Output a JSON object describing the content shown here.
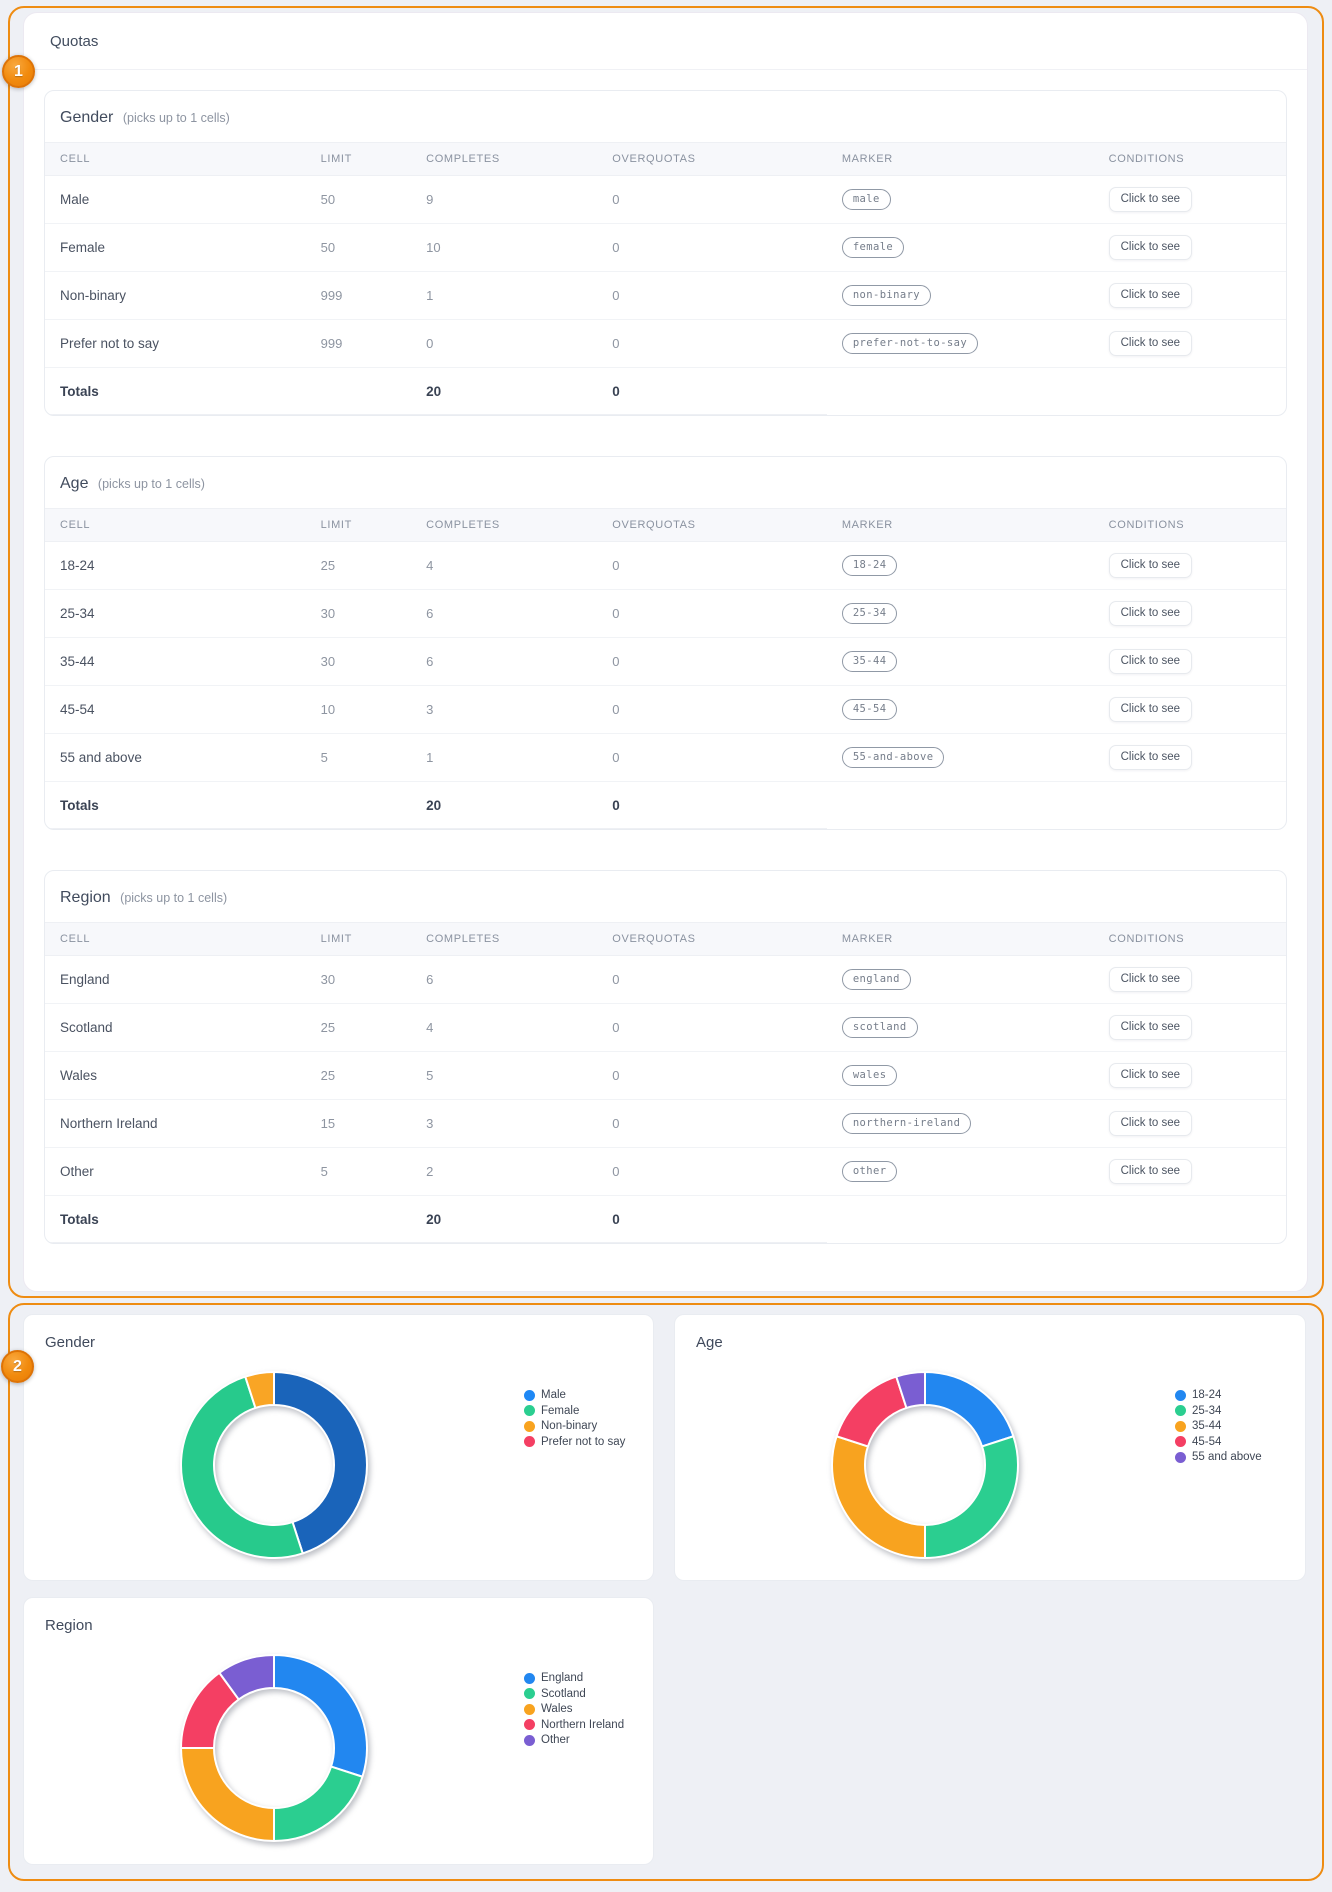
{
  "accent": {
    "annotation_orange": "#ee8c12",
    "badge_fill": "#f18a0d"
  },
  "annotations": {
    "badge_one": "1",
    "badge_two": "2"
  },
  "quotas_panel": {
    "title": "Quotas",
    "columns": [
      "CELL",
      "LIMIT",
      "COMPLETES",
      "OVERQUOTAS",
      "MARKER",
      "CONDITIONS"
    ],
    "condition_label": "Click to see",
    "totals_label": "Totals",
    "tables": [
      {
        "name": "Gender",
        "note": "(picks up to 1 cells)",
        "rows": [
          {
            "cell": "Male",
            "limit": "50",
            "completes": "9",
            "overquotas": "0",
            "marker": "male"
          },
          {
            "cell": "Female",
            "limit": "50",
            "completes": "10",
            "overquotas": "0",
            "marker": "female"
          },
          {
            "cell": "Non-binary",
            "limit": "999",
            "completes": "1",
            "overquotas": "0",
            "marker": "non-binary"
          },
          {
            "cell": "Prefer not to say",
            "limit": "999",
            "completes": "0",
            "overquotas": "0",
            "marker": "prefer-not-to-say"
          }
        ],
        "totals": {
          "completes": "20",
          "overquotas": "0"
        }
      },
      {
        "name": "Age",
        "note": "(picks up to 1 cells)",
        "rows": [
          {
            "cell": "18-24",
            "limit": "25",
            "completes": "4",
            "overquotas": "0",
            "marker": "18-24"
          },
          {
            "cell": "25-34",
            "limit": "30",
            "completes": "6",
            "overquotas": "0",
            "marker": "25-34"
          },
          {
            "cell": "35-44",
            "limit": "30",
            "completes": "6",
            "overquotas": "0",
            "marker": "35-44"
          },
          {
            "cell": "45-54",
            "limit": "10",
            "completes": "3",
            "overquotas": "0",
            "marker": "45-54"
          },
          {
            "cell": "55 and above",
            "limit": "5",
            "completes": "1",
            "overquotas": "0",
            "marker": "55-and-above"
          }
        ],
        "totals": {
          "completes": "20",
          "overquotas": "0"
        }
      },
      {
        "name": "Region",
        "note": "(picks up to 1 cells)",
        "rows": [
          {
            "cell": "England",
            "limit": "30",
            "completes": "6",
            "overquotas": "0",
            "marker": "england"
          },
          {
            "cell": "Scotland",
            "limit": "25",
            "completes": "4",
            "overquotas": "0",
            "marker": "scotland"
          },
          {
            "cell": "Wales",
            "limit": "25",
            "completes": "5",
            "overquotas": "0",
            "marker": "wales"
          },
          {
            "cell": "Northern Ireland",
            "limit": "15",
            "completes": "3",
            "overquotas": "0",
            "marker": "northern-ireland"
          },
          {
            "cell": "Other",
            "limit": "5",
            "completes": "2",
            "overquotas": "0",
            "marker": "other"
          }
        ],
        "totals": {
          "completes": "20",
          "overquotas": "0"
        }
      }
    ]
  },
  "chart_data": [
    {
      "type": "donut",
      "title": "Gender",
      "legend_position": "right",
      "categories": [
        "Male",
        "Female",
        "Non-binary",
        "Prefer not to say"
      ],
      "values": [
        9,
        10,
        1,
        0
      ],
      "colors": [
        "#1e88f5",
        "#2bce90",
        "#f8a31f",
        "#f43f63"
      ],
      "slice_colors": [
        "#1a64ba",
        "#27ca8c",
        "#f9a525",
        "#f43f63"
      ]
    },
    {
      "type": "donut",
      "title": "Age",
      "legend_position": "right",
      "categories": [
        "18-24",
        "25-34",
        "35-44",
        "45-54",
        "55 and above"
      ],
      "values": [
        4,
        6,
        6,
        3,
        1
      ],
      "colors": [
        "#2287f0",
        "#2bce90",
        "#f8a31f",
        "#f43f63",
        "#7a5ed2"
      ]
    },
    {
      "type": "donut",
      "title": "Region",
      "legend_position": "right",
      "categories": [
        "England",
        "Scotland",
        "Wales",
        "Northern Ireland",
        "Other"
      ],
      "values": [
        6,
        4,
        5,
        3,
        2
      ],
      "colors": [
        "#2287f0",
        "#2bce90",
        "#f8a31f",
        "#f43f63",
        "#7a5ed2"
      ]
    }
  ]
}
